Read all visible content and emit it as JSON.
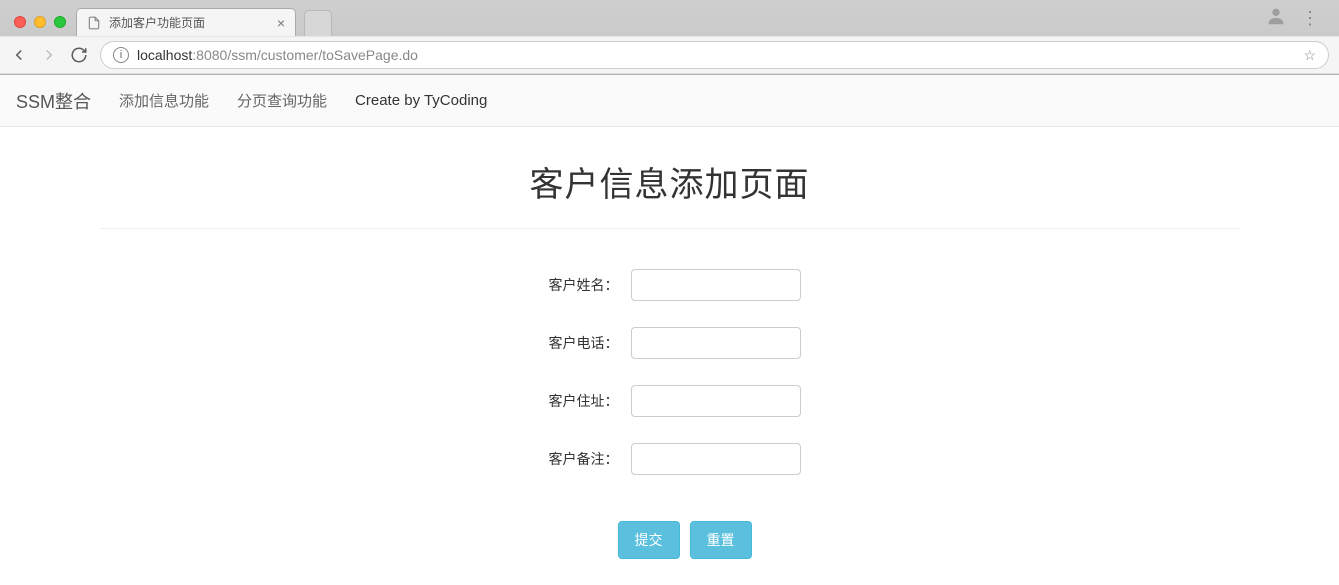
{
  "browser": {
    "tab_title": "添加客户功能页面",
    "url_host": "localhost",
    "url_port": ":8080",
    "url_path": "/ssm/customer/toSavePage.do"
  },
  "navbar": {
    "brand": "SSM整合",
    "link_add": "添加信息功能",
    "link_page": "分页查询功能",
    "credit": "Create by TyCoding"
  },
  "page": {
    "title": "客户信息添加页面"
  },
  "form": {
    "fields": [
      {
        "label": "客户姓名：",
        "value": ""
      },
      {
        "label": "客户电话：",
        "value": ""
      },
      {
        "label": "客户住址：",
        "value": ""
      },
      {
        "label": "客户备注：",
        "value": ""
      }
    ],
    "submit_label": "提交",
    "reset_label": "重置"
  }
}
